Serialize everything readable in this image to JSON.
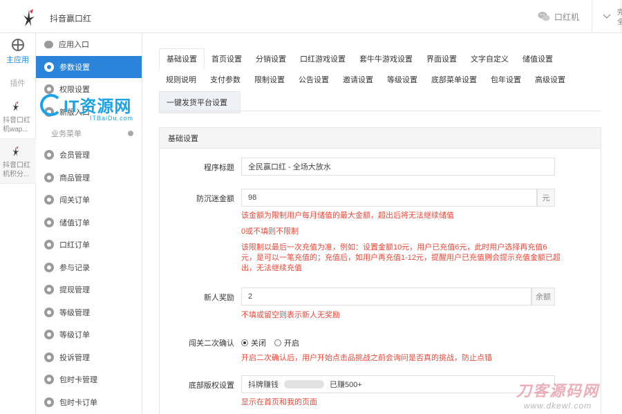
{
  "app": {
    "title": "抖音赢口红"
  },
  "topbar": {
    "account": "口红机",
    "edge": "完全"
  },
  "appcol": {
    "home_label": "主应用",
    "group_label": "插件",
    "items": [
      {
        "label": "抖音口红机wap..."
      },
      {
        "label": "抖音口红机积分..."
      }
    ]
  },
  "menu": {
    "items_top": [
      {
        "label": "应用入口",
        "icon": "bubble-icon"
      },
      {
        "label": "参数设置",
        "icon": "gear-icon",
        "active": true
      },
      {
        "label": "权限设置",
        "icon": "gear-icon"
      },
      {
        "label": "新版入口",
        "icon": "gear-icon"
      }
    ],
    "group": "业务菜单",
    "items": [
      {
        "label": "会员管理"
      },
      {
        "label": "商品管理"
      },
      {
        "label": "闯关订单"
      },
      {
        "label": "储值订单"
      },
      {
        "label": "口红订单"
      },
      {
        "label": "参与记录"
      },
      {
        "label": "提现管理"
      },
      {
        "label": "等级管理"
      },
      {
        "label": "等级订单"
      },
      {
        "label": "投诉管理"
      },
      {
        "label": "包时卡管理"
      },
      {
        "label": "包时卡订单"
      }
    ]
  },
  "tabs": {
    "row1": [
      "基础设置",
      "首页设置",
      "分销设置",
      "口红游戏设置",
      "套牛牛游戏设置",
      "界面设置",
      "文字自定义",
      "储值设置"
    ],
    "row2": [
      "规则说明",
      "支付参数",
      "限制设置",
      "公告设置",
      "邀请设置",
      "等级设置",
      "底部菜单设置",
      "包年设置",
      "高级设置"
    ],
    "row3": [
      "一键发货平台设置"
    ]
  },
  "panel": {
    "title": "基础设置",
    "program_title_label": "程序标题",
    "program_title_value": "全民赢口红 - 全场大放水",
    "anti_label": "防沉迷金额",
    "anti_value": "98",
    "anti_unit": "元",
    "anti_hint1": "该金额为限制用户每月储值的最大金额，超出后将无法继续储值",
    "anti_hint2": "0或不填则不限制",
    "anti_hint3": "该限制以最后一次充值为准，例如：设置金额10元，用户已充值6元，此时用户选择再充值6元，是可以一笔充值的；充值后，如用户再充值1-12元，提醒用户已充值则会提示充值金额已超出，无法继续充值",
    "newbie_label": "新人奖励",
    "newbie_value": "2",
    "newbie_unit": "余额",
    "newbie_hint": "不填或留空则表示新人无奖励",
    "confirm_label": "闯关二次确认",
    "confirm_off": "关闭",
    "confirm_on": "开启",
    "confirm_hint": "开启二次确认后，用户开始点击品挑战之前会询问是否真的挑战，防止点错",
    "bottom_label": "底部版权设置",
    "bottom_value_a": "抖牌赚钱",
    "bottom_value_b": "已赚500+",
    "bottom_hint": "显示在首页和我的页面"
  },
  "watermarks": {
    "a_main": "IT资源网",
    "a_sub": "ITBaiDu.com",
    "b_main": "刀客源码网",
    "b_sub": "www.dkewl.com"
  }
}
